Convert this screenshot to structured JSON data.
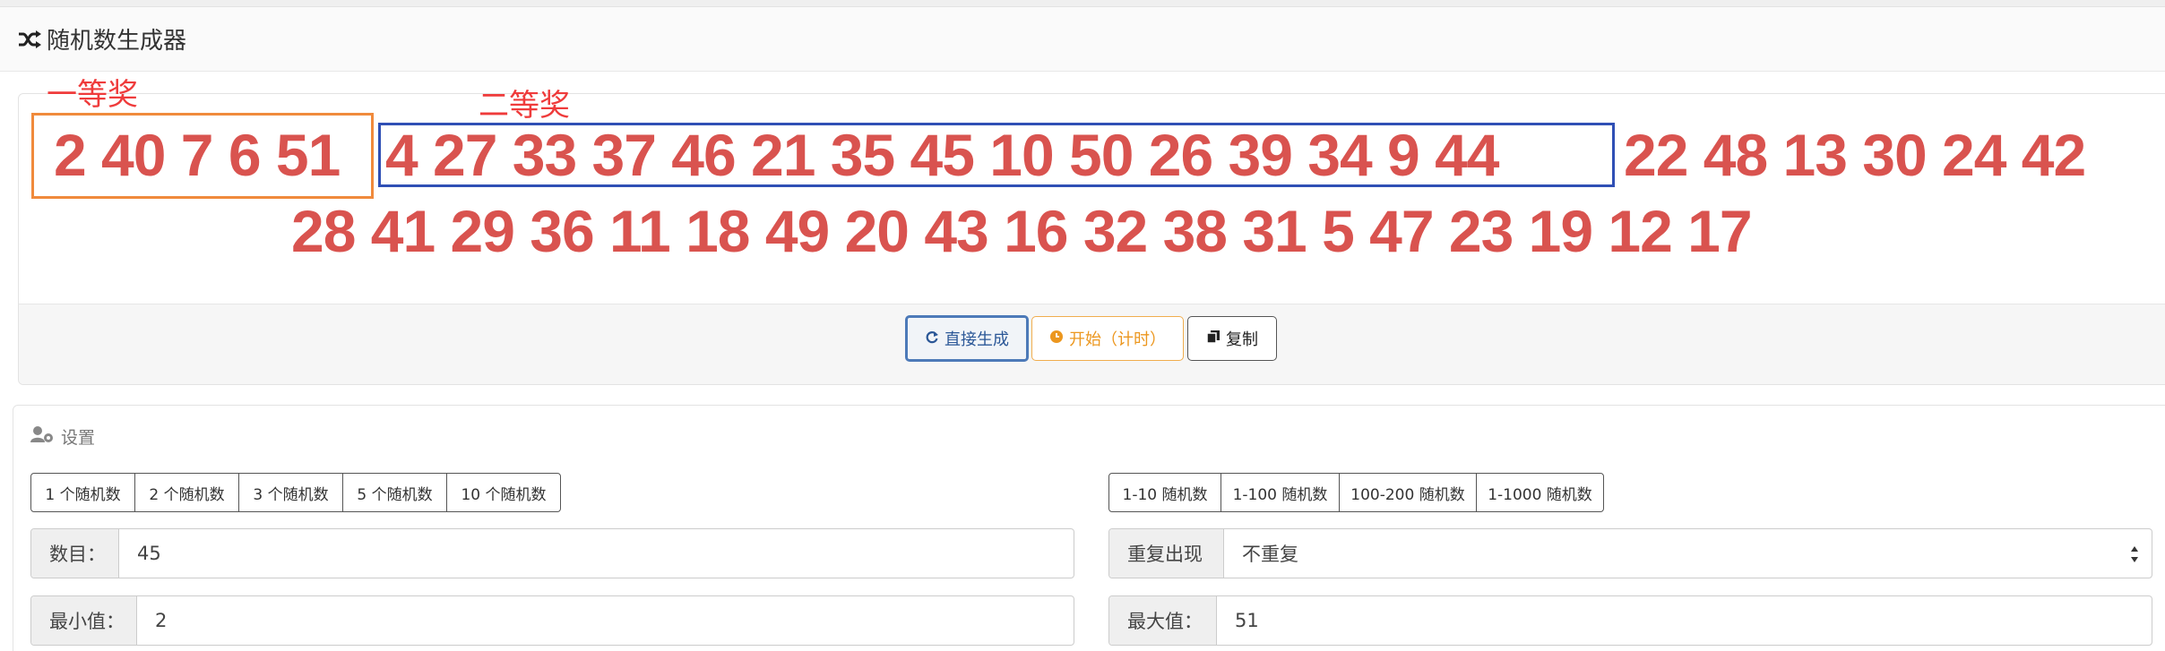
{
  "header": {
    "title": "随机数生成器",
    "icon": "shuffle-icon"
  },
  "result": {
    "annotations": {
      "first_prize": "一等奖",
      "second_prize": "二等奖"
    },
    "prize1_numbers": "2 40 7 6 51",
    "prize2_numbers": "4 27 33 37 46 21 35 45 10 50 26 39 34 9 44",
    "rest_line1": "22 48 13 30 24 42",
    "line2": "28 41 29 36 11 18 49 20 43 16 32 38 31 5 47 23 19 12 17",
    "colors": {
      "numbers": "#d9534f",
      "annotation": "#ef3b3b",
      "box1": "#f08a3c",
      "box2": "#2f4fb5"
    }
  },
  "actions": {
    "generate": "直接生成",
    "start": "开始（计时）",
    "copy": "复制"
  },
  "settings": {
    "title": "设置",
    "count_presets": [
      "1 个随机数",
      "2 个随机数",
      "3 个随机数",
      "5 个随机数",
      "10 个随机数"
    ],
    "range_presets": [
      "1-10 随机数",
      "1-100 随机数",
      "100-200 随机数",
      "1-1000 随机数"
    ],
    "count": {
      "label": "数目：",
      "value": "45"
    },
    "repeat": {
      "label": "重复出现",
      "value": "不重复"
    },
    "min": {
      "label": "最小值：",
      "value": "2"
    },
    "max": {
      "label": "最大值：",
      "value": "51"
    }
  }
}
